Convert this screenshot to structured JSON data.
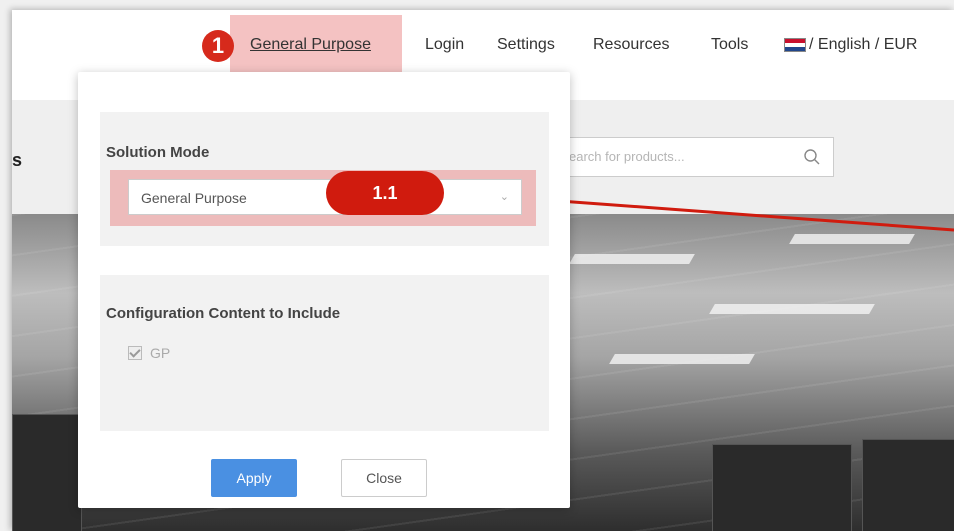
{
  "nav": {
    "items": [
      {
        "label": "General Purpose"
      },
      {
        "label": "Login"
      },
      {
        "label": "Settings"
      },
      {
        "label": "Resources"
      },
      {
        "label": "Tools"
      },
      {
        "label": "/ English / EUR"
      }
    ],
    "flag_icon": "netherlands-flag-icon"
  },
  "page": {
    "side_heading": "s",
    "search": {
      "placeholder": "earch for products..."
    }
  },
  "popup": {
    "solution_mode": {
      "title": "Solution Mode",
      "selected": "General Purpose",
      "chevron_icon": "chevron-down-icon"
    },
    "config": {
      "title": "Configuration Content to Include",
      "option": {
        "label": "GP",
        "checked": true
      }
    },
    "apply_label": "Apply",
    "close_label": "Close"
  },
  "annotations": {
    "step1": "1",
    "step1_1": "1.1",
    "highlight_color": "#e67878",
    "badge_color": "#d01b0e",
    "arrow_color": "#d01b0e"
  }
}
